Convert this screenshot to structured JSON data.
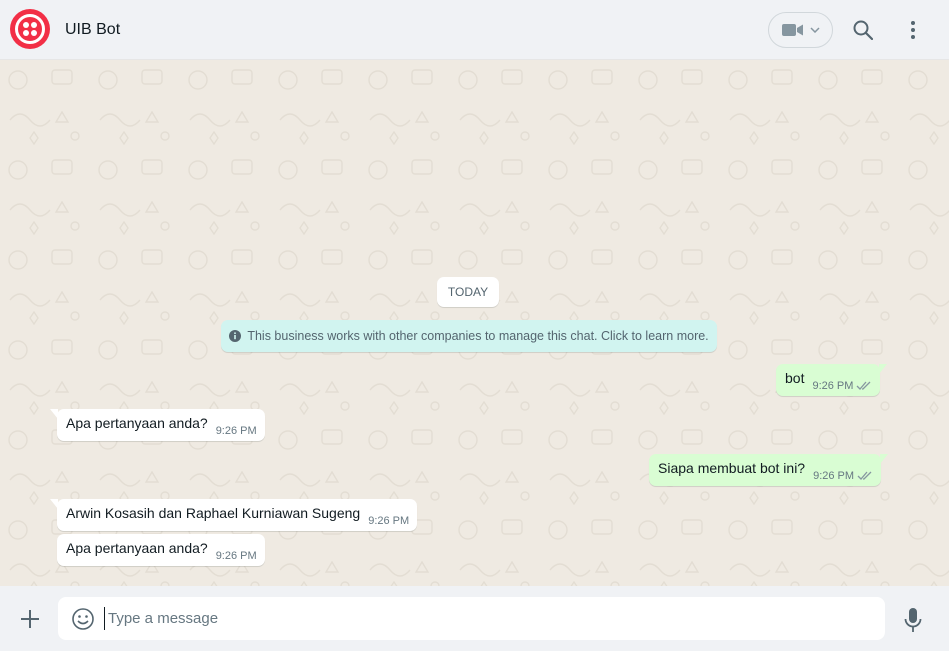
{
  "header": {
    "title": "UIB Bot",
    "brand_color": "#f22f46",
    "icons": [
      "video-camera-icon",
      "chevron-down-icon",
      "search-icon",
      "menu-icon"
    ]
  },
  "chat": {
    "date_label": "TODAY",
    "system_message": "This business works with other companies to manage this chat. Click to learn more.",
    "messages": [
      {
        "direction": "out",
        "text": "bot",
        "time": "9:26 PM",
        "status": "read"
      },
      {
        "direction": "in",
        "text": "Apa pertanyaan anda?",
        "time": "9:26 PM"
      },
      {
        "direction": "out",
        "text": "Siapa membuat bot ini?",
        "time": "9:26 PM",
        "status": "read"
      },
      {
        "direction": "in",
        "text": "Arwin Kosasih dan Raphael Kurniawan Sugeng",
        "time": "9:26 PM"
      },
      {
        "direction": "in",
        "text": "Apa pertanyaan anda?",
        "time": "9:26 PM"
      }
    ]
  },
  "composer": {
    "placeholder": "Type a message",
    "value": "",
    "icons": [
      "plus-icon",
      "emoji-icon",
      "microphone-icon"
    ]
  }
}
